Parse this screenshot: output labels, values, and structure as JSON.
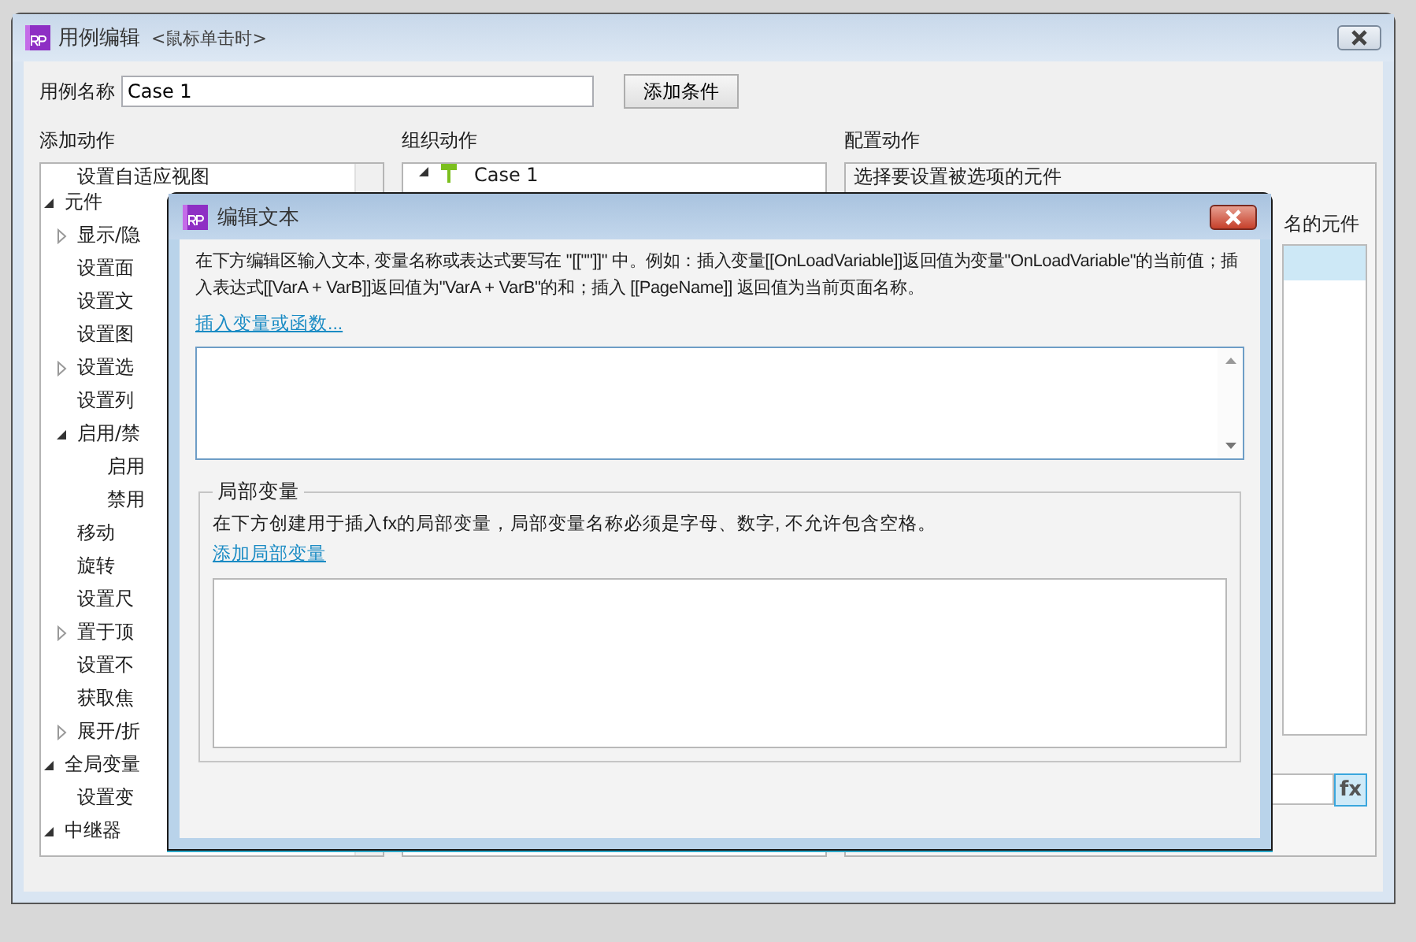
{
  "window": {
    "title": "用例编辑",
    "event": "<鼠标单击时>"
  },
  "case_name": {
    "label": "用例名称",
    "value": "Case 1"
  },
  "add_condition_button": "添加条件",
  "add_actions": {
    "heading": "添加动作",
    "tree": [
      {
        "children": [
          {
            "label": "设置自适应视图"
          }
        ]
      },
      {
        "label": "元件",
        "expanded": true,
        "children": [
          {
            "label": "显示/隐",
            "expanded": false
          },
          {
            "label": "设置面"
          },
          {
            "label": "设置文"
          },
          {
            "label": "设置图"
          },
          {
            "label": "设置选",
            "expanded": false
          },
          {
            "label": "设置列"
          },
          {
            "label": "启用/禁",
            "expanded": true,
            "children": [
              {
                "label": "启用"
              },
              {
                "label": "禁用"
              }
            ]
          },
          {
            "label": "移动"
          },
          {
            "label": "旋转"
          },
          {
            "label": "设置尺"
          },
          {
            "label": "置于顶",
            "expanded": false
          },
          {
            "label": "设置不"
          },
          {
            "label": "获取焦"
          },
          {
            "label": "展开/折",
            "expanded": false
          }
        ]
      },
      {
        "label": "全局变量",
        "expanded": true,
        "children": [
          {
            "label": "设置变"
          }
        ]
      },
      {
        "label": "中继器",
        "expanded": true
      }
    ]
  },
  "organize_actions": {
    "heading": "组织动作",
    "tree": [
      {
        "label": "Case 1",
        "expanded": true
      }
    ]
  },
  "configure_actions": {
    "heading": "配置动作",
    "prompt": "选择要设置被选项的元件",
    "column_header": "名的元件",
    "rows": [
      {
        "selected": true
      }
    ],
    "fx_button": "fx"
  },
  "dialog": {
    "title": "编辑文本",
    "description": "在下方编辑区输入文本, 变量名称或表达式要写在 \"[[\"\"]]\" 中。例如：插入变量[[OnLoadVariable]]返回值为变量\"OnLoadVariable\"的当前值；插入表达式[[VarA + VarB]]返回值为\"VarA + VarB\"的和；插入 [[PageName]] 返回值为当前页面名称。",
    "insert_link": "插入变量或函数...",
    "local_variables": {
      "legend": "局部变量",
      "description": "在下方创建用于插入fx的局部变量，局部变量名称必须是字母、数字, 不允许包含空格。",
      "add_link": "添加局部变量"
    }
  }
}
